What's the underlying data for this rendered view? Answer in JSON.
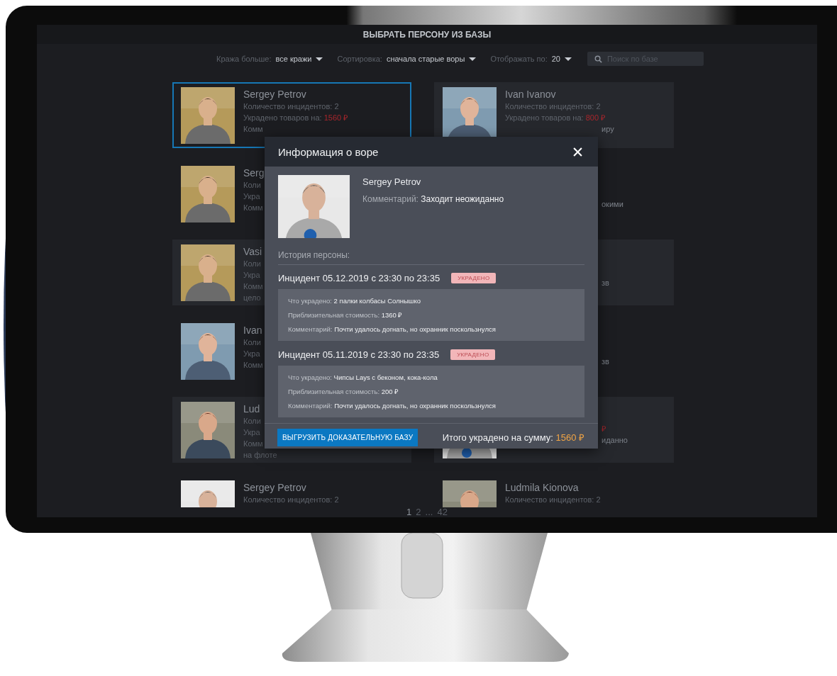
{
  "header": {
    "title": "ВЫБРАТЬ ПЕРСОНУ ИЗ БАЗЫ"
  },
  "filters": [
    {
      "label": "Кража больше:",
      "value": "все кражи"
    },
    {
      "label": "Сортировка:",
      "value": "сначала старые воры"
    },
    {
      "label": "Отображать по:",
      "value": "20"
    }
  ],
  "search": {
    "placeholder": "Поиск по базе"
  },
  "cards": [
    {
      "selected": true,
      "shaded": false,
      "photo": {
        "kind": "picture"
      },
      "lines": [
        {
          "kind": "name",
          "text": "Sergey Petrov"
        },
        {
          "kind": "plain",
          "text": "Количество инцидентов: 2"
        },
        {
          "kind": "amount",
          "label": "Украдено товаров на:",
          "value": "1560 ₽"
        },
        {
          "kind": "plain",
          "text": "Комм"
        }
      ]
    },
    {
      "selected": false,
      "shaded": true,
      "photo": {
        "kind": "picture"
      },
      "lines": [
        {
          "kind": "name",
          "text": "Ivan Ivanov"
        },
        {
          "kind": "plain",
          "text": "Количество инцидентов: 2"
        },
        {
          "kind": "amount",
          "label": "Украдено товаров на:",
          "value": "800 ₽"
        },
        {
          "kind": "tail",
          "text": "иру"
        }
      ]
    },
    {
      "selected": false,
      "shaded": false,
      "photo": {
        "kind": "picture"
      },
      "lines": [
        {
          "kind": "name",
          "text": "Serg"
        },
        {
          "kind": "plain",
          "text": "Коли"
        },
        {
          "kind": "plain",
          "text": "Укра"
        },
        {
          "kind": "plain",
          "text": "Комм"
        }
      ]
    },
    {
      "selected": false,
      "shaded": false,
      "lines": [
        {
          "kind": "tail",
          "text": "окими"
        }
      ]
    },
    {
      "selected": false,
      "shaded": true,
      "photo": {
        "kind": "picture"
      },
      "lines": [
        {
          "kind": "name",
          "text": "Vasi"
        },
        {
          "kind": "plain",
          "text": "Коли"
        },
        {
          "kind": "plain",
          "text": "Укра"
        },
        {
          "kind": "plain",
          "text": "Комм"
        },
        {
          "kind": "plain",
          "text": "цело"
        }
      ]
    },
    {
      "selected": false,
      "shaded": true,
      "lines": [
        {
          "kind": "tail",
          "text": "зв"
        }
      ]
    },
    {
      "selected": false,
      "shaded": false,
      "photo": {
        "kind": "picture"
      },
      "lines": [
        {
          "kind": "name",
          "text": "Ivan"
        },
        {
          "kind": "plain",
          "text": "Коли"
        },
        {
          "kind": "plain",
          "text": "Укра"
        },
        {
          "kind": "plain",
          "text": "Комм"
        }
      ]
    },
    {
      "selected": false,
      "shaded": false,
      "lines": [
        {
          "kind": "tail",
          "text": "зв"
        }
      ]
    },
    {
      "selected": false,
      "shaded": true,
      "photo": {
        "kind": "picture"
      },
      "lines": [
        {
          "kind": "name",
          "text": "Lud"
        },
        {
          "kind": "plain",
          "text": "Коли"
        },
        {
          "kind": "plain",
          "text": "Укра"
        },
        {
          "kind": "plain",
          "text": "Комм"
        },
        {
          "kind": "plain",
          "text": "на флоте"
        }
      ]
    },
    {
      "selected": false,
      "shaded": true,
      "photo": {
        "kind": "picture"
      },
      "lines": [
        {
          "kind": "tail-amount",
          "text": "₽"
        },
        {
          "kind": "tail",
          "text": "иданно"
        }
      ]
    },
    {
      "selected": false,
      "shaded": false,
      "photo": {
        "kind": "picture"
      },
      "lines": [
        {
          "kind": "name",
          "text": "Sergey Petrov"
        },
        {
          "kind": "plain",
          "text": "Количество инцидентов: 2"
        }
      ]
    },
    {
      "selected": false,
      "shaded": false,
      "photo": {
        "kind": "picture"
      },
      "lines": [
        {
          "kind": "name",
          "text": "Ludmila Kionova"
        },
        {
          "kind": "plain",
          "text": "Количество инцидентов: 2"
        }
      ]
    }
  ],
  "pagination": [
    {
      "label": "1",
      "selected": true
    },
    {
      "label": "2",
      "selected": false
    },
    {
      "label": "...",
      "selected": false
    },
    {
      "label": "42",
      "selected": false
    }
  ],
  "modal": {
    "title": "Информация о воре",
    "person": {
      "name": "Sergey Petrov",
      "comment_label": "Комментарий:",
      "comment": "Заходит неожиданно",
      "photo": {
        "kind": "picture"
      }
    },
    "history_label": "История персоны:",
    "incidents": [
      {
        "title": "Инцидент 05.12.2019 с 23:30 по 23:35",
        "status": "УКРАДЕНО",
        "details": [
          {
            "label": "Что украдено:",
            "value": "2 палки колбасы Солнышко"
          },
          {
            "label": "Приблизительная стоимость:",
            "value": "1360 ₽"
          },
          {
            "label": "Комментарий:",
            "value": "Почти удалось догнать, но охранник поскользнулся"
          }
        ]
      },
      {
        "title": "Инцидент 05.11.2019 с 23:30 по 23:35",
        "status": "УКРАДЕНО",
        "details": [
          {
            "label": "Что украдено:",
            "value": "Чипсы Lays с беконом, кока-кола"
          },
          {
            "label": "Приблизительная стоимость:",
            "value": "200 ₽"
          },
          {
            "label": "Комментарий:",
            "value": "Почти удалось догнать, но охранник поскользнулся"
          }
        ]
      }
    ],
    "export_button": "ВЫГРУЗИТЬ ДОКАЗАТЕЛЬНУЮ БАЗУ",
    "total_label": "Итого украдено на сумму:",
    "total_value": "1560 ₽"
  }
}
